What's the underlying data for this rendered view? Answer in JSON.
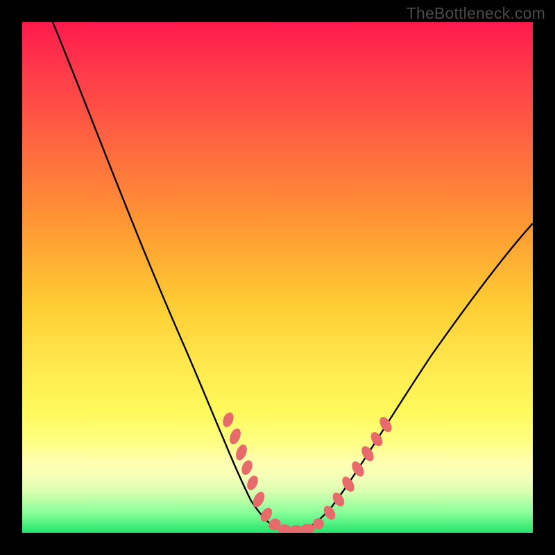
{
  "watermark": "TheBottleneck.com",
  "chart_data": {
    "type": "line",
    "title": "",
    "xlabel": "",
    "ylabel": "",
    "xlim": [
      0,
      100
    ],
    "ylim": [
      0,
      100
    ],
    "series": [
      {
        "name": "curve",
        "x": [
          6,
          10,
          15,
          20,
          25,
          30,
          35,
          40,
          43,
          46,
          48,
          50,
          52,
          54,
          57,
          60,
          65,
          70,
          75,
          80,
          85,
          90,
          95,
          100
        ],
        "y": [
          100,
          90,
          79,
          67,
          56,
          45,
          34,
          22,
          14,
          7,
          3,
          1,
          0,
          0,
          2,
          6,
          14,
          23,
          32,
          40,
          48,
          55,
          61,
          65
        ]
      }
    ],
    "markers": {
      "name": "highlighted-points",
      "color": "#e76b6b",
      "x": [
        40,
        41.5,
        42,
        43,
        44,
        45,
        47,
        49,
        50,
        51,
        52,
        53,
        54,
        55,
        57,
        60,
        61,
        62,
        63
      ],
      "y": [
        22,
        19,
        17,
        14,
        11,
        8,
        4,
        1,
        0.5,
        0,
        0,
        0,
        0,
        0.5,
        2,
        6,
        8,
        10,
        12
      ]
    },
    "background": {
      "type": "vertical-gradient",
      "stops": [
        {
          "pos": 0.0,
          "color": "#ff1a4d"
        },
        {
          "pos": 0.4,
          "color": "#ff9933"
        },
        {
          "pos": 0.75,
          "color": "#ffff66"
        },
        {
          "pos": 1.0,
          "color": "#22e56b"
        }
      ]
    }
  }
}
